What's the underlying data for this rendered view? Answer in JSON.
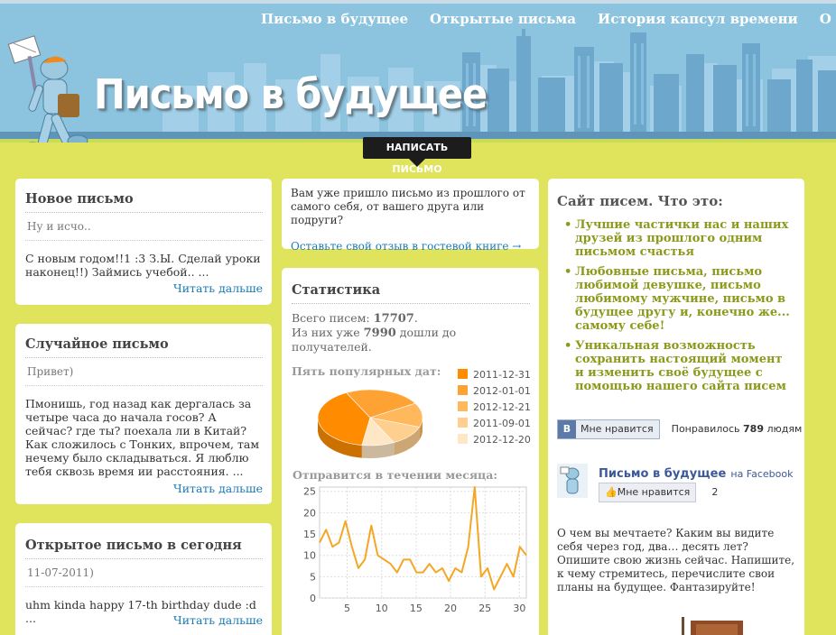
{
  "nav": {
    "items": [
      "Письмо в будущее",
      "Открытые письма",
      "История капсул времени",
      "О проекте"
    ]
  },
  "header": {
    "title": "Письмо в будущее",
    "write_button": "НАПИСАТЬ ПИСЬМО"
  },
  "new_letter": {
    "title": "Новое письмо",
    "subtitle": "Ну и исчо..",
    "text": "С новым годом!!1 :3 З.Ы. Сделай уроки наконец!!) Займись учебой.. ...",
    "more": "Читать дальше"
  },
  "random_letter": {
    "title": "Случайное письмо",
    "subtitle": "Привет)",
    "text": "Пмонишь, год назад как дергалась за четыре часа до начала госов? А сейчас? где ты? поехала ли в Китай? Как сложилось с Тонких, впрочем, там нечему было складываться. Я люблю тебя сквозь время ии расстояния. ...",
    "more": "Читать дальше"
  },
  "open_letter_today": {
    "title": "Открытое письмо в сегодня",
    "subtitle": "11-07-2011)",
    "text": "uhm kinda happy 17-th birthday dude :d ...",
    "more": "Читать дальше"
  },
  "intro": {
    "text": "Вам уже пришло письмо из прошлого от самого себя, от вашего друга или подруги?",
    "link": "Оставьте свой отзыв в гостевой книге →"
  },
  "stats": {
    "title": "Статистика",
    "total_prefix": "Всего писем:",
    "total_value": "17707",
    "total_suffix": ".",
    "delivered_prefix": "Из них уже",
    "delivered_value": "7990",
    "delivered_suffix": "дошли до получателей.",
    "popular_dates_title": "Пять популярных дат:",
    "month_title": "Отправится в течении месяца:"
  },
  "chart_data": [
    {
      "type": "pie",
      "title": "Пять популярных дат:",
      "categories": [
        "2011-12-31",
        "2012-01-01",
        "2012-12-21",
        "2011-09-01",
        "2012-12-20"
      ],
      "values": [
        40,
        24,
        14,
        12,
        10
      ],
      "colors": [
        "#ff8c00",
        "#ffa234",
        "#ffb85c",
        "#ffcf90",
        "#ffe6c4"
      ],
      "legend": "right"
    },
    {
      "type": "line",
      "title": "Отправится в течении месяца:",
      "x": [
        1,
        2,
        3,
        4,
        5,
        6,
        7,
        8,
        9,
        10,
        11,
        12,
        13,
        14,
        15,
        16,
        17,
        18,
        19,
        20,
        21,
        22,
        23,
        24,
        25,
        26,
        27,
        28,
        29,
        30,
        31
      ],
      "series": [
        {
          "values": [
            13,
            16,
            12,
            13,
            18,
            12,
            7,
            9,
            17,
            10,
            9,
            8,
            6,
            9,
            9,
            6,
            6,
            8,
            6,
            7,
            4,
            7,
            6,
            12,
            26,
            5,
            7,
            2,
            5,
            8,
            5,
            12,
            10
          ]
        }
      ],
      "xticks": [
        5,
        10,
        15,
        20,
        25,
        30
      ],
      "yticks": [
        0,
        5,
        10,
        15,
        20,
        25
      ],
      "xlim": [
        1,
        31
      ],
      "ylim": [
        0,
        26
      ],
      "grid": true,
      "color": "#f5a623"
    }
  ],
  "about": {
    "title": "Сайт писем. Что это:",
    "bullets": [
      "Лучшие частички нас и наших друзей из прошлого одним письмом счастья",
      "Любовные письма, письмо любимой девушке, письмо любимому мужчине, письмо в будущее другу и, конечно же... самому себе!",
      "Уникальная возможность сохранить настоящий момент и изменить своё будущее с помощью нашего сайта писем"
    ],
    "like_label": "Мне нравится",
    "liked_prefix": "Понравилось",
    "liked_count": "789",
    "liked_suffix": "людям",
    "fb_page_name": "Письмо в будущее",
    "fb_on": "на Facebook",
    "fb_like_label": "Мне нравится",
    "fb_like_count": "2",
    "invite_text": "О чем вы мечтаете? Каким вы видите себя через год, два… десять лет? Опишите свою жизнь сейчас. Напишите, к чему стремитесь, перечислите свои планы на будущее. Фантазируйте!"
  },
  "colors": {
    "background": "#dfe45c",
    "header_sky": "#8cc4e0",
    "link": "#1a7ab2",
    "accent_green": "#8c9a1c",
    "chart_orange": "#f5a623"
  }
}
